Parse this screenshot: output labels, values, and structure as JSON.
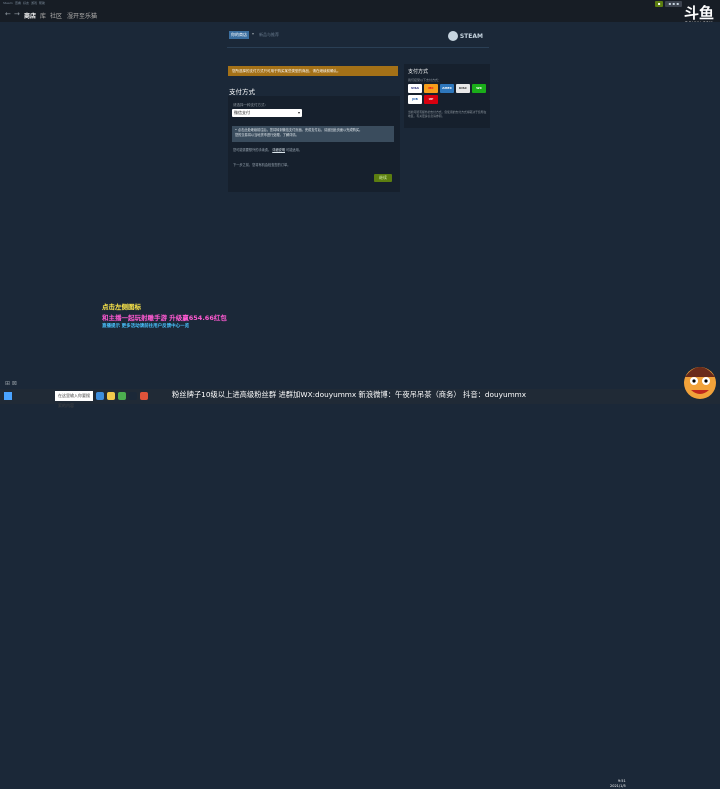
{
  "titlebar": {
    "items": [
      "Steam",
      "查看",
      "好友",
      "游戏",
      "帮助"
    ],
    "right_pill": "▪ ▪ ▪",
    "online_pill": "▪"
  },
  "nav": {
    "links": [
      "商店",
      "库",
      "社区",
      "湿开至乐猫"
    ]
  },
  "watermark": {
    "logo": "斗鱼",
    "domain": "DOUYU.COM"
  },
  "header": {
    "shop_tab": "你的商店",
    "store_link": "新品与推荐",
    "brand": "STEAM"
  },
  "notice": "您所选择的支付方式只可用于购买某些类型的商品，请在继续前确认。",
  "payment": {
    "title": "支付方式",
    "choose_label": "请选择一种支付方式：",
    "selected": "微信支付",
    "info_text": "• 点击此处继续前往后，您将转到微信支付页面。完成支付后，请返回此页面以完成购买。",
    "info_text2": "您的交易将以当地货币进行处理。了解详情。",
    "note_text": "您可能需要额外的手续费。",
    "note_link": "详细说明",
    "note_tail": "可能适用。",
    "next_note": "下一步之前，您将有机会检查您的订单。",
    "next_button": "继续"
  },
  "side": {
    "title": "支付方式",
    "subtitle": "我们接受以下支付方式：",
    "logos": [
      "VISA",
      "MC",
      "AMEX",
      "DISC",
      "WX",
      "JCB",
      "UP"
    ],
    "footnote": "当前可能有额外的支付方式。您使用的支付方式将取决于您所在地区。有关更多信息请参阅。"
  },
  "overlay": {
    "line1": "点击左侧图标",
    "line2": "和主播一起玩射雕手游 升级赢654.66红包",
    "line3": "直播提示 更多活动请前往用户反馈中心一览"
  },
  "statusbar": {
    "left": "⊞ ⊠"
  },
  "taskbar": {
    "search_placeholder": "在这里输入你要搜索的内容",
    "marquee": "粉丝牌子10级以上进高级粉丝群 进群加WX:douyummx 新浪微博：午夜吊吊茶（商务）   抖音：douyummx",
    "clock_time": "9:51",
    "clock_date": "2021/1/5"
  },
  "colors": {
    "accent": "#5c7e10",
    "notice": "#a47117",
    "bg": "#1b2838"
  }
}
